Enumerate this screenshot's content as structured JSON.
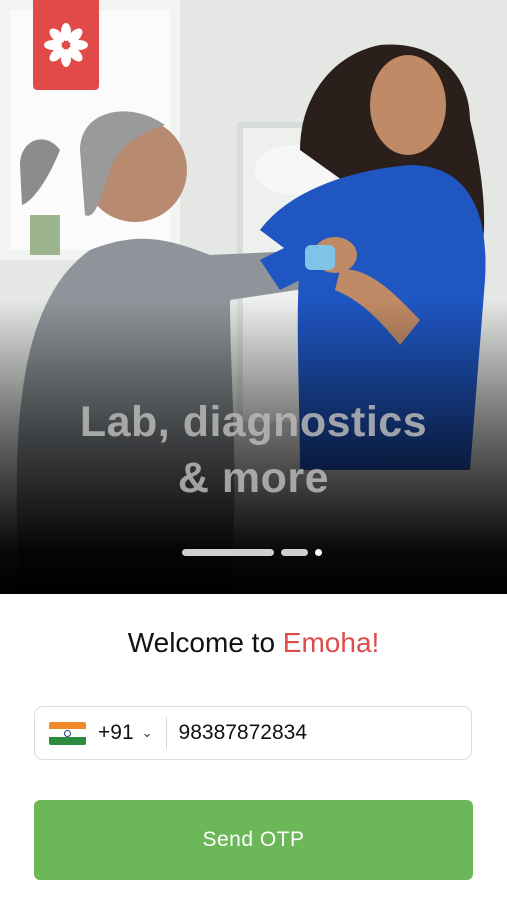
{
  "hero": {
    "line1": "Lab, diagnostics",
    "line2": "& more",
    "carousel": {
      "total": 3,
      "active": 3
    }
  },
  "welcome": {
    "prefix": "Welcome to ",
    "brand": "Emoha!"
  },
  "phone": {
    "country_code": "+91",
    "flag": "india-flag-icon",
    "number": "98387872834"
  },
  "send_button": {
    "label": "Send OTP"
  },
  "colors": {
    "brand_red": "#e24a4a",
    "accent_green": "#6cb859"
  }
}
